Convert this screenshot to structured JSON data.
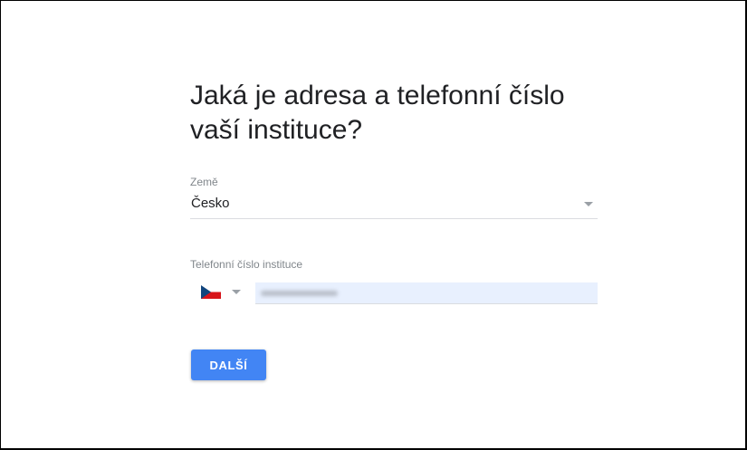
{
  "form": {
    "heading": "Jaká je adresa a telefonní číslo vaší instituce?",
    "country": {
      "label": "Země",
      "value": "Česko"
    },
    "phone": {
      "label": "Telefonní číslo instituce",
      "flag_icon": "czech-flag-icon",
      "input_background": "#e8f0fe"
    },
    "next_button": {
      "label": "DALŠÍ",
      "color": "#4285f4"
    }
  }
}
